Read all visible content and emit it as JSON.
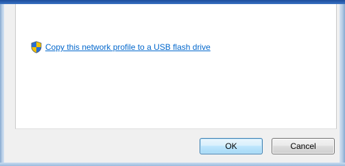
{
  "content": {
    "link": {
      "icon": "shield-icon",
      "label": "Copy this network profile to a USB flash drive"
    }
  },
  "buttons": {
    "ok_label": "OK",
    "cancel_label": "Cancel"
  },
  "colors": {
    "link": "#0066cc",
    "title_bar": "#1d4d9b",
    "frame": "#c4d7ec",
    "dialog_background": "#f0f0f0",
    "panel_background": "#ffffff"
  }
}
